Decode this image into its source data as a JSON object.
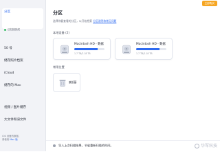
{
  "top_button": {
    "label": "立即购买"
  },
  "sidebar": {
    "active_item": {
      "label": "分区",
      "sub_status": "已扫描完成"
    },
    "section_label": "",
    "items": [
      {
        "id": "50gb",
        "label": "50 号"
      },
      {
        "id": "mail",
        "label": "储存照片档案"
      },
      {
        "id": "icloud",
        "label": "iCloud"
      },
      {
        "id": "mac",
        "label": "储存的 Mac"
      },
      {
        "id": "video",
        "label": "视频 / 图片储存"
      },
      {
        "id": "large",
        "label": "大文件和旧文件"
      }
    ],
    "footer": {
      "line1": "iOS 设备的数据，",
      "line2": "请使用",
      "link": "Mac 版"
    }
  },
  "main": {
    "title": "分区",
    "description": "选择你要查看的分区，以开始检索",
    "description_link": "分区说明和常见问题",
    "local_devices_label": "本地设备 (2)",
    "devices": [
      {
        "name": "Macintosh HD - 数据",
        "size": "1.7 TB/2.18 TB",
        "usage": 0.78
      },
      {
        "name": "Macintosh HD - 数据",
        "size": "1.7 TB/2.18 TB",
        "usage": 0.78
      }
    ],
    "common_locations_label": "常用位置",
    "trash": {
      "label": "废纸篓"
    }
  },
  "bottom_bar": {
    "text": "导入上次扫描结果，节省重新扫描的时间。"
  },
  "watermark": {
    "text": "华军科技"
  },
  "colors": {
    "accent": "#2f6bf0",
    "button": "#f6a623",
    "status": "#3cbf6a"
  }
}
